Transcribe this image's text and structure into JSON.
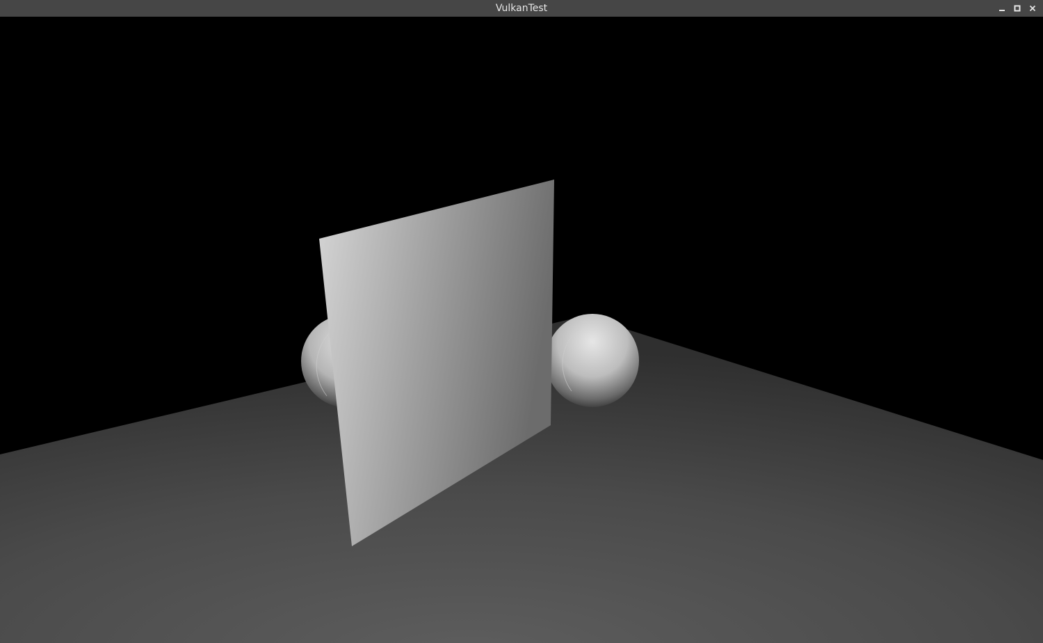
{
  "window": {
    "title": "VulkanTest"
  },
  "controls": {
    "minimize_icon": "minimize-icon",
    "maximize_icon": "maximize-icon",
    "close_icon": "close-icon"
  },
  "colors": {
    "titlebar": "#464646",
    "title_text": "#e8e8e8",
    "background": "#000000",
    "floor_near": "#5e5e5e",
    "floor_far": "#343434",
    "plane_light": "#d9d9d9",
    "plane_dark": "#6e6e6e"
  }
}
